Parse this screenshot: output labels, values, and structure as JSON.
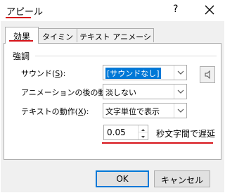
{
  "window": {
    "title": "アピール",
    "help_label": "?",
    "close_icon": "close-icon"
  },
  "tabs": [
    {
      "label": "効果",
      "active": true
    },
    {
      "label": "タイミング",
      "active": false
    },
    {
      "label": "テキスト アニメーション",
      "active": false
    }
  ],
  "group": {
    "title": "強調"
  },
  "fields": {
    "sound": {
      "label_before": "サウンド(",
      "mnemonic": "S",
      "label_after": "):",
      "value": "[サウンドなし]"
    },
    "after_anim": {
      "label": "アニメーションの後の動作",
      "value": "淡しない"
    },
    "text_anim": {
      "label_before": "テキストの動作(",
      "mnemonic": "X",
      "label_after": "):",
      "value": "文字単位で表示"
    },
    "delay": {
      "value": "0.05",
      "suffix": "秒文字間で遅延"
    }
  },
  "buttons": {
    "ok": "OK",
    "cancel": "キャンセル"
  },
  "colors": {
    "accent": "#d7141a",
    "selection": "#0078d7"
  }
}
